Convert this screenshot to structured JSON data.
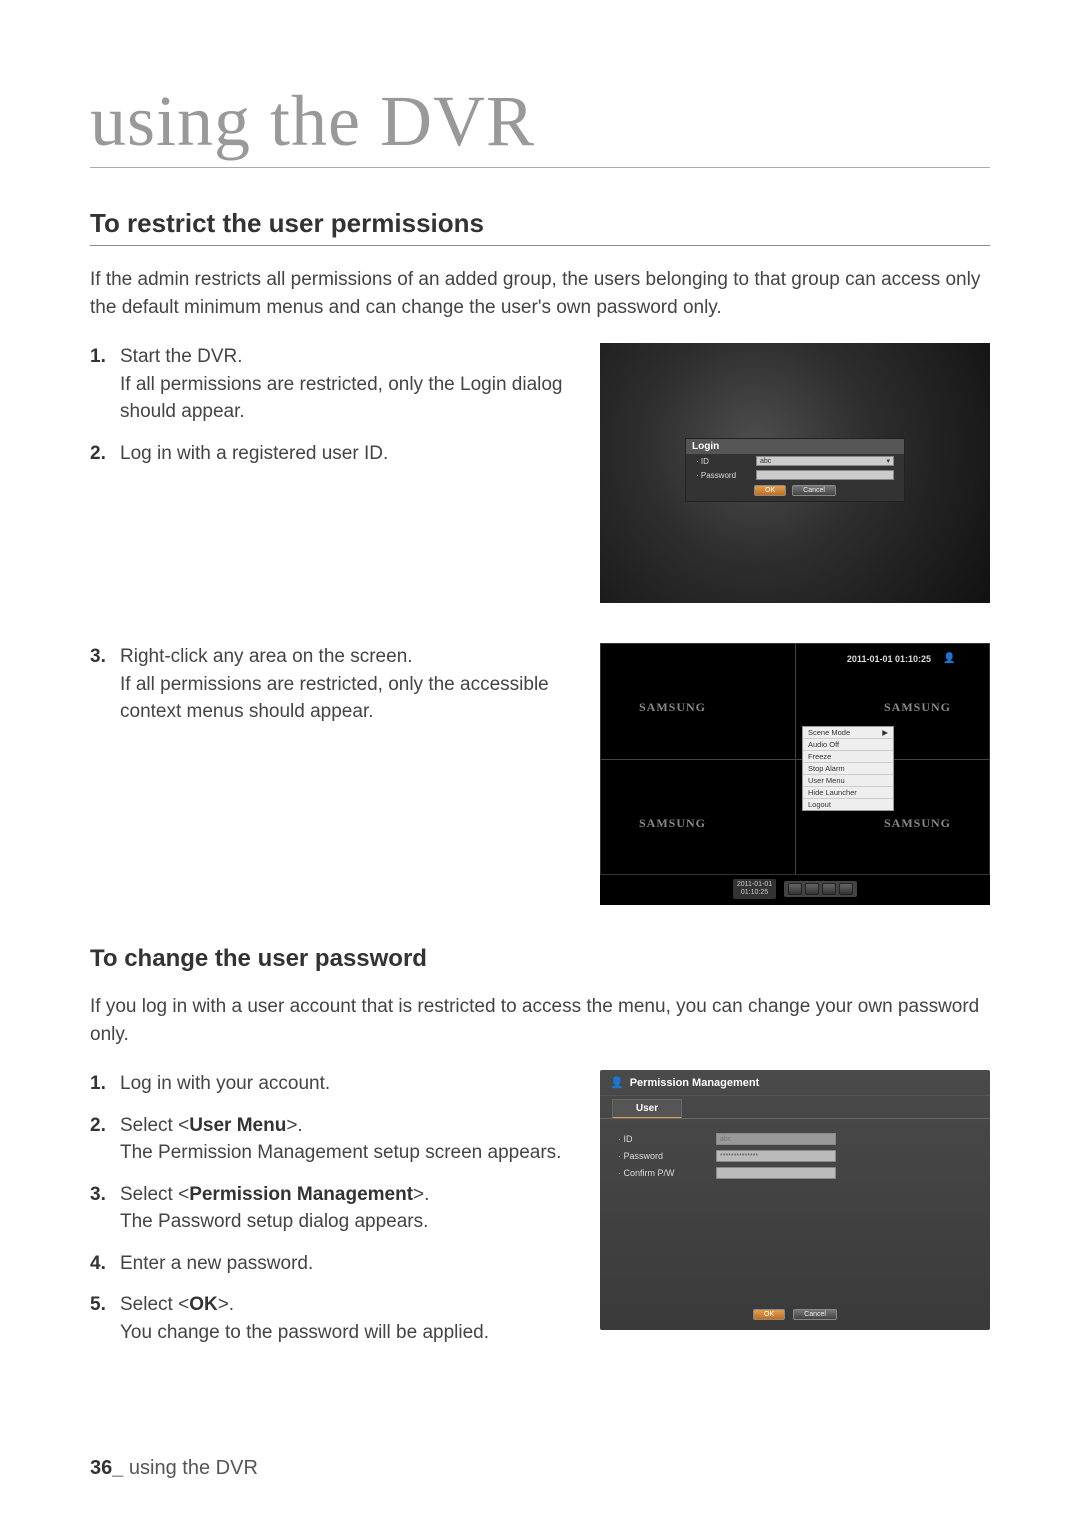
{
  "chapter_title": "using the DVR",
  "sec1": {
    "title": "To restrict the user permissions",
    "intro": "If the admin restricts all permissions of an added group, the users belonging to that group can access only the default minimum menus and can change the user's own password only.",
    "steps": {
      "s1_num": "1.",
      "s1_a": "Start the DVR.",
      "s1_b": "If all permissions are restricted, only the Login dialog should appear.",
      "s2_num": "2.",
      "s2_a": "Log in with a registered user ID.",
      "s3_num": "3.",
      "s3_a": "Right-click any area on the screen.",
      "s3_b": "If all permissions are restricted, only the accessible context menus should appear."
    }
  },
  "fig1": {
    "title": "Login",
    "id_label": "· ID",
    "id_value": "abc",
    "pw_label": "· Password",
    "ok": "OK",
    "cancel": "Cancel"
  },
  "fig2": {
    "timestamp_top": "2011-01-01 01:10:25",
    "brand": "SAMSUNG",
    "ctx": {
      "scene_mode": "Scene Mode",
      "audio_off": "Audio Off",
      "freeze": "Freeze",
      "stop_alarm": "Stop Alarm",
      "user_menu": "User Menu",
      "hide_launcher": "Hide Launcher",
      "logout": "Logout",
      "arrow": "▶"
    },
    "bb_date": "2011-01-01",
    "bb_time": "01:10:25"
  },
  "sec2": {
    "title": "To change the user password",
    "intro": "If you log in with a user account that is restricted to access the menu, you can change your own password only.",
    "s1_num": "1.",
    "s1": "Log in with your account.",
    "s2_num": "2.",
    "s2_a": "Select <",
    "s2_b": "User Menu",
    "s2_c": ">.",
    "s2_d": "The Permission Management setup screen appears.",
    "s3_num": "3.",
    "s3_a": "Select <",
    "s3_b": "Permission Management",
    "s3_c": ">.",
    "s3_d": "The Password setup dialog appears.",
    "s4_num": "4.",
    "s4": "Enter a new password.",
    "s5_num": "5.",
    "s5_a": "Select <",
    "s5_b": "OK",
    "s5_c": ">.",
    "s5_d": "You change to the password will be applied."
  },
  "fig3": {
    "header": "Permission Management",
    "tab": "User",
    "id_label": "· ID",
    "id_value": "abc",
    "pw_label": "· Password",
    "pw_value": "**************",
    "cf_label": "· Confirm P/W",
    "cf_value": "",
    "ok": "OK",
    "cancel": "Cancel"
  },
  "footer": {
    "page_num": "36_",
    "label": " using the DVR"
  }
}
